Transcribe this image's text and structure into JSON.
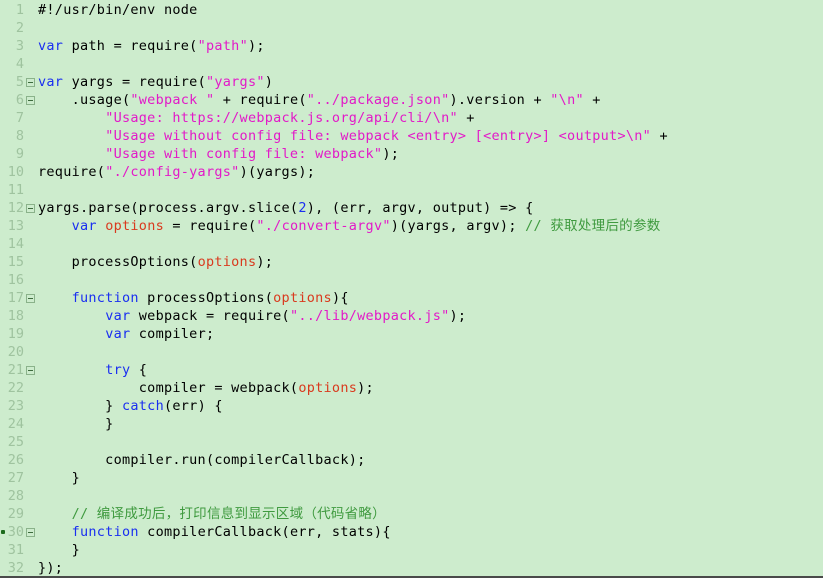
{
  "editor": {
    "background_color": "#cdeccd",
    "line_number_color": "#9fc39f",
    "keyword_color": "#1a2ff0",
    "string_color": "#e21ac8",
    "comment_color": "#3f9a3f",
    "variable_color": "#d93a1e",
    "text_color": "#000000",
    "total_lines": 32,
    "breakpoint_line": 30,
    "fold_lines": [
      5,
      6,
      12,
      17,
      21,
      30
    ]
  },
  "lines": [
    {
      "n": "1",
      "fold": false,
      "bp": false,
      "tokens": [
        {
          "t": "plain",
          "s": "#!/usr/bin/env node"
        }
      ]
    },
    {
      "n": "2",
      "fold": false,
      "bp": false,
      "tokens": []
    },
    {
      "n": "3",
      "fold": false,
      "bp": false,
      "tokens": [
        {
          "t": "kw",
          "s": "var"
        },
        {
          "t": "plain",
          "s": " path = require("
        },
        {
          "t": "str",
          "s": "\"path\""
        },
        {
          "t": "plain",
          "s": ");"
        }
      ]
    },
    {
      "n": "4",
      "fold": false,
      "bp": false,
      "tokens": []
    },
    {
      "n": "5",
      "fold": true,
      "bp": false,
      "tokens": [
        {
          "t": "kw",
          "s": "var"
        },
        {
          "t": "plain",
          "s": " yargs = require("
        },
        {
          "t": "str",
          "s": "\"yargs\""
        },
        {
          "t": "plain",
          "s": ")"
        }
      ]
    },
    {
      "n": "6",
      "fold": true,
      "bp": false,
      "tokens": [
        {
          "t": "plain",
          "s": "    .usage("
        },
        {
          "t": "str",
          "s": "\"webpack \""
        },
        {
          "t": "plain",
          "s": " + require("
        },
        {
          "t": "str",
          "s": "\"../package.json\""
        },
        {
          "t": "plain",
          "s": ").version + "
        },
        {
          "t": "str",
          "s": "\"\\n\""
        },
        {
          "t": "plain",
          "s": " +"
        }
      ]
    },
    {
      "n": "7",
      "fold": false,
      "bp": false,
      "tokens": [
        {
          "t": "plain",
          "s": "        "
        },
        {
          "t": "str",
          "s": "\"Usage: https://webpack.js.org/api/cli/\\n\""
        },
        {
          "t": "plain",
          "s": " +"
        }
      ]
    },
    {
      "n": "8",
      "fold": false,
      "bp": false,
      "tokens": [
        {
          "t": "plain",
          "s": "        "
        },
        {
          "t": "str",
          "s": "\"Usage without config file: webpack <entry> [<entry>] <output>\\n\""
        },
        {
          "t": "plain",
          "s": " +"
        }
      ]
    },
    {
      "n": "9",
      "fold": false,
      "bp": false,
      "tokens": [
        {
          "t": "plain",
          "s": "        "
        },
        {
          "t": "str",
          "s": "\"Usage with config file: webpack\""
        },
        {
          "t": "plain",
          "s": ");"
        }
      ]
    },
    {
      "n": "10",
      "fold": false,
      "bp": false,
      "tokens": [
        {
          "t": "plain",
          "s": "require("
        },
        {
          "t": "str",
          "s": "\"./config-yargs\""
        },
        {
          "t": "plain",
          "s": ")(yargs);"
        }
      ]
    },
    {
      "n": "11",
      "fold": false,
      "bp": false,
      "tokens": []
    },
    {
      "n": "12",
      "fold": true,
      "bp": false,
      "tokens": [
        {
          "t": "plain",
          "s": "yargs.parse(process.argv.slice("
        },
        {
          "t": "num",
          "s": "2"
        },
        {
          "t": "plain",
          "s": "), (err, argv, output) => {"
        }
      ]
    },
    {
      "n": "13",
      "fold": false,
      "bp": false,
      "tokens": [
        {
          "t": "plain",
          "s": "    "
        },
        {
          "t": "kw",
          "s": "var"
        },
        {
          "t": "plain",
          "s": " "
        },
        {
          "t": "var",
          "s": "options"
        },
        {
          "t": "plain",
          "s": " = require("
        },
        {
          "t": "str",
          "s": "\"./convert-argv\""
        },
        {
          "t": "plain",
          "s": ")(yargs, argv); "
        },
        {
          "t": "cmt",
          "s": "// 获取处理后的参数"
        }
      ]
    },
    {
      "n": "14",
      "fold": false,
      "bp": false,
      "tokens": []
    },
    {
      "n": "15",
      "fold": false,
      "bp": false,
      "tokens": [
        {
          "t": "plain",
          "s": "    processOptions("
        },
        {
          "t": "var",
          "s": "options"
        },
        {
          "t": "plain",
          "s": ");"
        }
      ]
    },
    {
      "n": "16",
      "fold": false,
      "bp": false,
      "tokens": []
    },
    {
      "n": "17",
      "fold": true,
      "bp": false,
      "tokens": [
        {
          "t": "plain",
          "s": "    "
        },
        {
          "t": "kw",
          "s": "function"
        },
        {
          "t": "plain",
          "s": " processOptions("
        },
        {
          "t": "var",
          "s": "options"
        },
        {
          "t": "plain",
          "s": "){"
        }
      ]
    },
    {
      "n": "18",
      "fold": false,
      "bp": false,
      "tokens": [
        {
          "t": "plain",
          "s": "        "
        },
        {
          "t": "kw",
          "s": "var"
        },
        {
          "t": "plain",
          "s": " webpack = require("
        },
        {
          "t": "str",
          "s": "\"../lib/webpack.js\""
        },
        {
          "t": "plain",
          "s": ");"
        }
      ]
    },
    {
      "n": "19",
      "fold": false,
      "bp": false,
      "tokens": [
        {
          "t": "plain",
          "s": "        "
        },
        {
          "t": "kw",
          "s": "var"
        },
        {
          "t": "plain",
          "s": " compiler;"
        }
      ]
    },
    {
      "n": "20",
      "fold": false,
      "bp": false,
      "tokens": []
    },
    {
      "n": "21",
      "fold": true,
      "bp": false,
      "tokens": [
        {
          "t": "plain",
          "s": "        "
        },
        {
          "t": "kw",
          "s": "try"
        },
        {
          "t": "plain",
          "s": " {"
        }
      ]
    },
    {
      "n": "22",
      "fold": false,
      "bp": false,
      "tokens": [
        {
          "t": "plain",
          "s": "            compiler = webpack("
        },
        {
          "t": "var",
          "s": "options"
        },
        {
          "t": "plain",
          "s": ");"
        }
      ]
    },
    {
      "n": "23",
      "fold": false,
      "bp": false,
      "tokens": [
        {
          "t": "plain",
          "s": "        } "
        },
        {
          "t": "kw",
          "s": "catch"
        },
        {
          "t": "plain",
          "s": "(err) {"
        }
      ]
    },
    {
      "n": "24",
      "fold": false,
      "bp": false,
      "tokens": [
        {
          "t": "plain",
          "s": "        }"
        }
      ]
    },
    {
      "n": "25",
      "fold": false,
      "bp": false,
      "tokens": []
    },
    {
      "n": "26",
      "fold": false,
      "bp": false,
      "tokens": [
        {
          "t": "plain",
          "s": "        compiler.run(compilerCallback);"
        }
      ]
    },
    {
      "n": "27",
      "fold": false,
      "bp": false,
      "tokens": [
        {
          "t": "plain",
          "s": "    }"
        }
      ]
    },
    {
      "n": "28",
      "fold": false,
      "bp": false,
      "tokens": []
    },
    {
      "n": "29",
      "fold": false,
      "bp": false,
      "tokens": [
        {
          "t": "plain",
          "s": "    "
        },
        {
          "t": "cmt",
          "s": "// 编译成功后，打印信息到显示区域（代码省略）"
        }
      ]
    },
    {
      "n": "30",
      "fold": true,
      "bp": true,
      "tokens": [
        {
          "t": "plain",
          "s": "    "
        },
        {
          "t": "kw",
          "s": "function"
        },
        {
          "t": "plain",
          "s": " compilerCallback(err, stats){"
        }
      ]
    },
    {
      "n": "31",
      "fold": false,
      "bp": false,
      "tokens": [
        {
          "t": "plain",
          "s": "    }"
        }
      ]
    },
    {
      "n": "32",
      "fold": false,
      "bp": false,
      "tokens": [
        {
          "t": "plain",
          "s": "});"
        }
      ]
    }
  ]
}
